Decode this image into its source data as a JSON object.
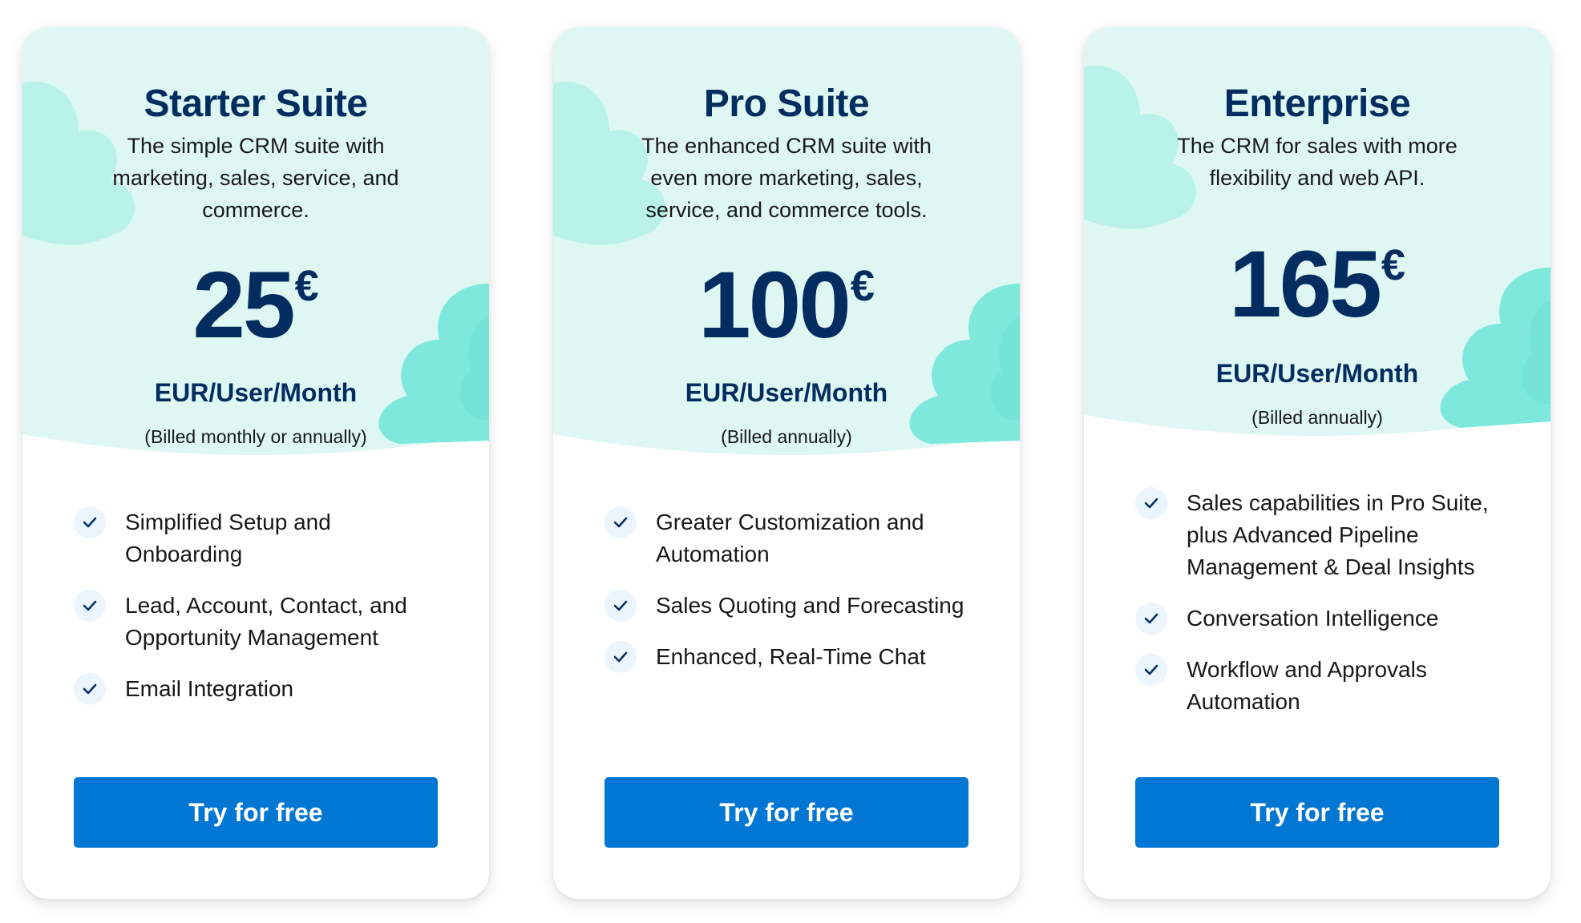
{
  "colors": {
    "title": "#032d60",
    "hero_background": "#dff7f2",
    "cloud": "#7ee8dc",
    "button": "#0176d3",
    "check_circle": "#eaf5fe"
  },
  "plans": [
    {
      "title": "Starter Suite",
      "description": "The simple CRM suite with marketing, sales, service, and commerce.",
      "price": "25",
      "currency": "€",
      "unit": "EUR/User/Month",
      "billing": "(Billed monthly or annually)",
      "features": [
        "Simplified Setup and Onboarding",
        "Lead, Account, Contact, and Opportunity Management",
        "Email Integration"
      ],
      "cta": "Try for free",
      "check_icon": "checkmark-icon"
    },
    {
      "title": "Pro Suite",
      "description": "The enhanced CRM suite with even more marketing, sales, service, and commerce tools.",
      "price": "100",
      "currency": "€",
      "unit": "EUR/User/Month",
      "billing": "(Billed annually)",
      "features": [
        "Greater Customization and Automation",
        "Sales Quoting and Forecasting",
        "Enhanced, Real-Time Chat"
      ],
      "cta": "Try for free",
      "check_icon": "checkmark-icon"
    },
    {
      "title": "Enterprise",
      "description": "The CRM for sales with more flexibility and web API.",
      "price": "165",
      "currency": "€",
      "unit": "EUR/User/Month",
      "billing": "(Billed annually)",
      "features": [
        "Sales capabilities in Pro Suite, plus Advanced Pipeline Management & Deal Insights",
        "Conversation Intelligence",
        "Workflow and Approvals Automation"
      ],
      "cta": "Try for free",
      "check_icon": "checkmark-icon"
    }
  ]
}
